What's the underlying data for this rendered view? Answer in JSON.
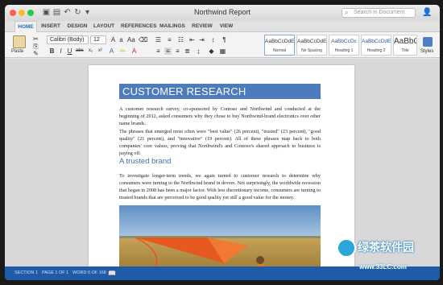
{
  "window": {
    "title": "Northwind Report"
  },
  "search": {
    "placeholder": "Search in Document"
  },
  "tabs": [
    {
      "label": "HOME"
    },
    {
      "label": "INSERT"
    },
    {
      "label": "DESIGN"
    },
    {
      "label": "LAYOUT"
    },
    {
      "label": "REFERENCES"
    },
    {
      "label": "MAILINGS"
    },
    {
      "label": "REVIEW"
    },
    {
      "label": "VIEW"
    }
  ],
  "ribbon": {
    "paste_label": "Paste",
    "font_name": "Calibri (Body)",
    "font_size": "12",
    "styles_label": "Styles",
    "styles": [
      {
        "sample": "AaBbCcDdEe",
        "name": "Normal"
      },
      {
        "sample": "AaBbCcDdEe",
        "name": "No Spacing"
      },
      {
        "sample": "AaBbCcDc",
        "name": "Heading 1"
      },
      {
        "sample": "AaBbCcDdE",
        "name": "Heading 2"
      },
      {
        "sample": "AaBbC",
        "name": "Title"
      }
    ]
  },
  "document": {
    "heading": "CUSTOMER RESEARCH",
    "para1": "A customer research survey, co-sponsored by Contoso and Northwind and conducted at the beginning of 2012, asked consumers why they chose to buy Northwind-brand electronics over other name brands.",
    "para2": "The phrases that emerged most often were \"best value\" (26 percent), \"trusted\" (23 percent), \"good quality\" (21 percent), and \"innovative\" (19 percent). All of these phrases map back to both companies' core values, proving that Northwind's and Contoso's shared approach to business is paying off.",
    "subheading": "A trusted brand",
    "para3": "To investigate longer-term trends, we again turned to customer research to determine why consumers were turning to the Northwind brand in droves. Not surprisingly, the worldwide recession that began in 2008 has been a major factor. With less discretionary income, consumers are turning to trusted brands that are perceived to be good quality yet still a good value for the money."
  },
  "status": {
    "section": "SECTION 1",
    "page": "PAGE 1 OF 1",
    "words": "WORD 0 OF 168"
  },
  "watermark": {
    "text": "绿茶软件园",
    "url": "www.33LC.com"
  },
  "colors": {
    "heading_band": "#4e7bbd",
    "statusbar": "#1e5ba8",
    "active_tab_text": "#1f6cb6"
  }
}
